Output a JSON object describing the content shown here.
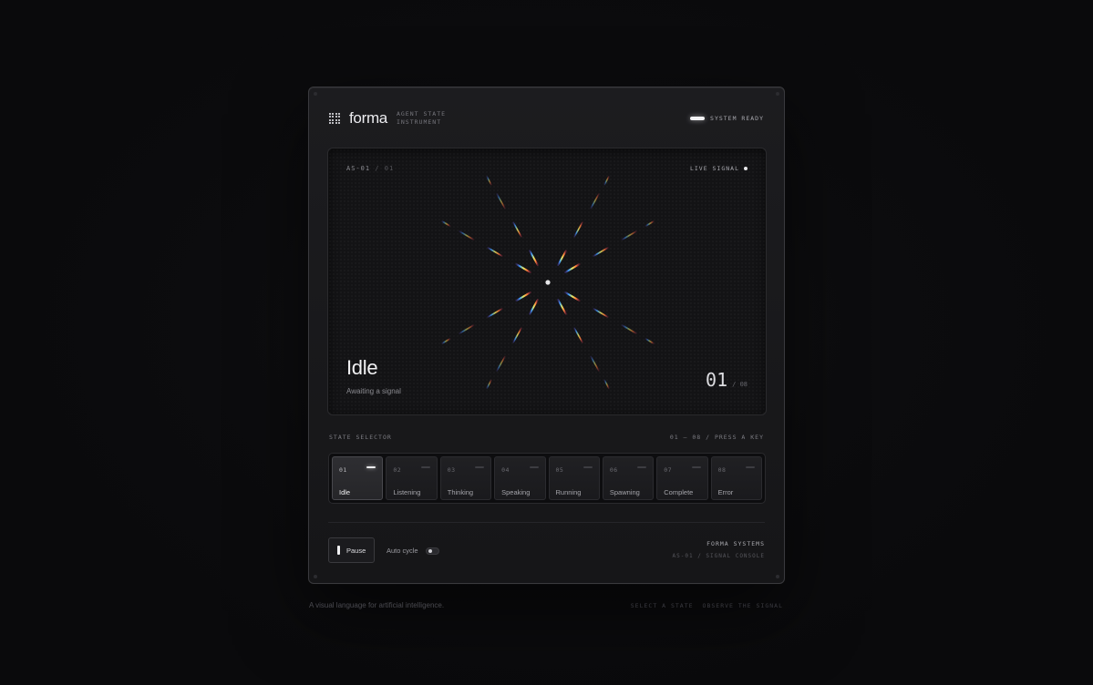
{
  "header": {
    "brand": "forma",
    "subtitle_line1": "AGENT STATE",
    "subtitle_line2": "INSTRUMENT",
    "status": "SYSTEM READY"
  },
  "screen": {
    "id": "AS-01",
    "id_sep": "/",
    "id_index": "01",
    "live": "LIVE SIGNAL",
    "state_title": "Idle",
    "state_desc": "Awaiting a signal",
    "counter_current": "01",
    "counter_total": "/ 08"
  },
  "selector": {
    "label": "STATE SELECTOR",
    "hint": "01 – 08 / PRESS A KEY",
    "keys": [
      {
        "num": "01",
        "label": "Idle",
        "active": true
      },
      {
        "num": "02",
        "label": "Listening",
        "active": false
      },
      {
        "num": "03",
        "label": "Thinking",
        "active": false
      },
      {
        "num": "04",
        "label": "Speaking",
        "active": false
      },
      {
        "num": "05",
        "label": "Running",
        "active": false
      },
      {
        "num": "06",
        "label": "Spawning",
        "active": false
      },
      {
        "num": "07",
        "label": "Complete",
        "active": false
      },
      {
        "num": "08",
        "label": "Error",
        "active": false
      }
    ]
  },
  "controls": {
    "pause_label": "Pause",
    "autocycle_label": "Auto cycle",
    "autocycle_on": false
  },
  "footer": {
    "company": "FORMA SYSTEMS",
    "model": "AS-01 / SIGNAL CONSOLE"
  },
  "page": {
    "tagline": "A visual language for artificial intelligence.",
    "hint1": "SELECT A STATE",
    "hint2": "OBSERVE THE SIGNAL"
  },
  "colors": {
    "background": "#0c0c0e",
    "panel": "#1a1a1c",
    "accent": "#f0f0f2"
  }
}
